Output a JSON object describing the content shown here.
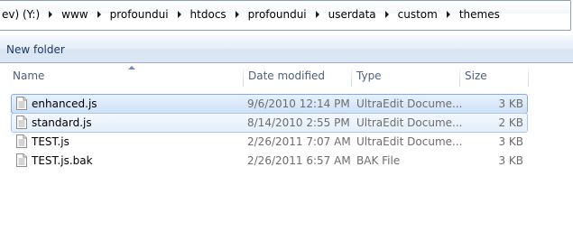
{
  "address": {
    "crumbs": [
      "ev) (Y:)",
      "www",
      "profoundui",
      "htdocs",
      "profoundui",
      "userdata",
      "custom",
      "themes"
    ]
  },
  "toolbar": {
    "new_folder_label": "New folder"
  },
  "columns": {
    "name": "Name",
    "date_modified": "Date modified",
    "type": "Type",
    "size": "Size"
  },
  "files": [
    {
      "name": "enhanced.js",
      "date": "9/6/2010 12:14 PM",
      "type": "UltraEdit Docume...",
      "size": "3 KB",
      "state": "selected"
    },
    {
      "name": "standard.js",
      "date": "8/14/2010 2:55 PM",
      "type": "UltraEdit Docume...",
      "size": "2 KB",
      "state": "focused"
    },
    {
      "name": "TEST.js",
      "date": "2/26/2011 7:07 AM",
      "type": "UltraEdit Docume...",
      "size": "3 KB",
      "state": "normal"
    },
    {
      "name": "TEST.js.bak",
      "date": "2/26/2011 6:57 AM",
      "type": "BAK File",
      "size": "3 KB",
      "state": "normal"
    }
  ],
  "colors": {
    "selection_bg": "#cde1f8",
    "selection_border": "#84acdd",
    "header_text": "#4c607a",
    "meta_text": "#6d6d6d"
  },
  "icons": {
    "file": "document-icon",
    "breadcrumb_separator": "chevron-right-icon",
    "sort": "sort-ascending-icon"
  }
}
